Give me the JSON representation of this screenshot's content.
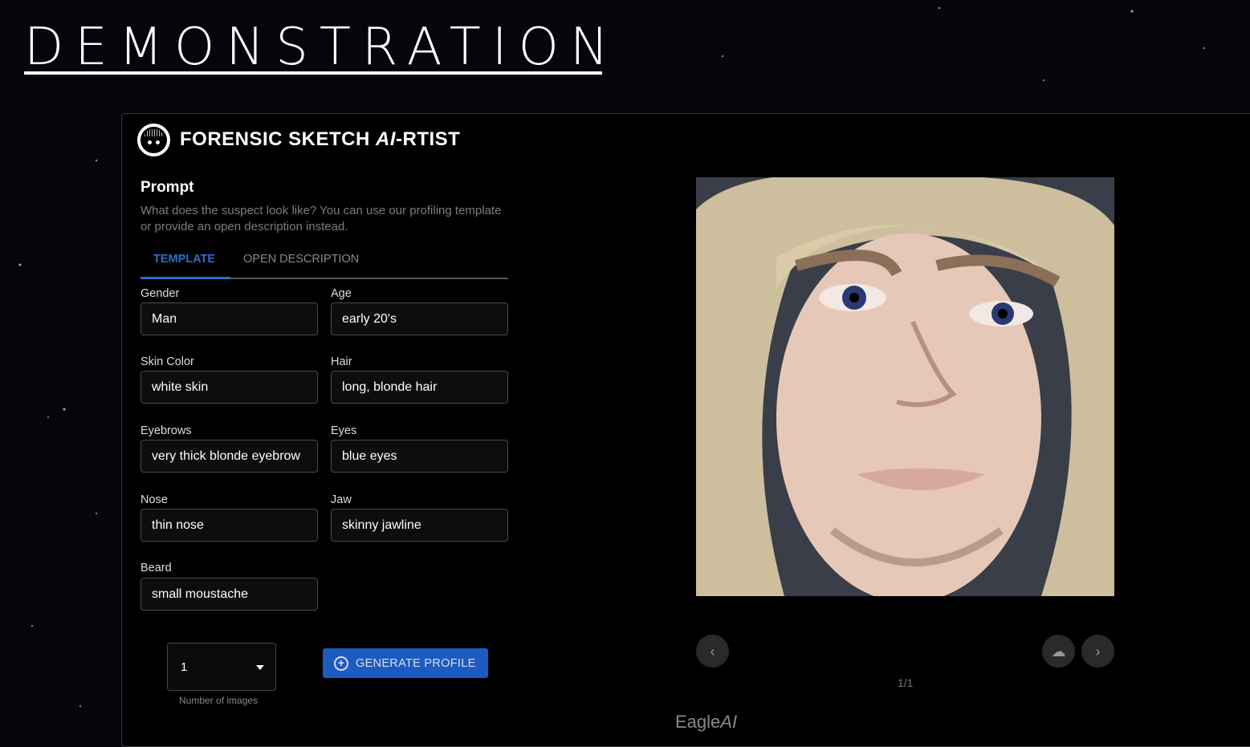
{
  "page": {
    "heading": "DEMONSTRATION"
  },
  "app": {
    "title": "FORENSIC SKETCH AI-RTIST",
    "title_main": "FORENSIC SKETCH ",
    "title_ai": "AI",
    "title_rest": "-RTIST"
  },
  "prompt": {
    "heading": "Prompt",
    "description": "What does the suspect look like? You can use our profiling template or provide an open description instead."
  },
  "tabs": [
    {
      "label": "TEMPLATE",
      "active": true
    },
    {
      "label": "OPEN DESCRIPTION",
      "active": false
    }
  ],
  "fields": {
    "gender": {
      "label": "Gender",
      "value": "Man"
    },
    "age": {
      "label": "Age",
      "value": "early 20's"
    },
    "skin": {
      "label": "Skin Color",
      "value": "white skin"
    },
    "hair": {
      "label": "Hair",
      "value": "long, blonde hair"
    },
    "eyebrows": {
      "label": "Eyebrows",
      "value": "very thick blonde eyebrow"
    },
    "eyes": {
      "label": "Eyes",
      "value": "blue eyes"
    },
    "nose": {
      "label": "Nose",
      "value": "thin nose"
    },
    "jaw": {
      "label": "Jaw",
      "value": "skinny jawline"
    },
    "beard": {
      "label": "Beard",
      "value": "small moustache"
    }
  },
  "num_images": {
    "value": "1",
    "label": "Number of images"
  },
  "generate": {
    "label": "GENERATE PROFILE"
  },
  "gallery": {
    "counter": "1/1"
  },
  "footer": {
    "brand": "Eagle",
    "brand_ai": "AI"
  },
  "colors": {
    "accent": "#1c5bbf",
    "tab_active": "#2f6cc9"
  }
}
